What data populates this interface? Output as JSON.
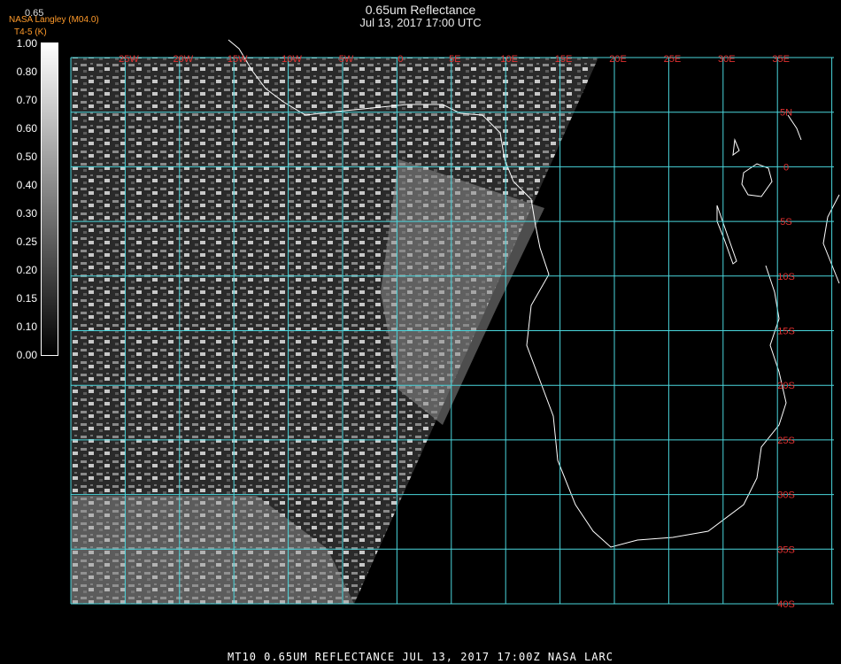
{
  "header": {
    "title": "0.65um Reflectance",
    "datetime": "Jul 13, 2017 17:00 UTC",
    "credit": "NASA Langley (M04.0)",
    "credit2": "T4-5 (K)",
    "scale_top": "0.65"
  },
  "legend": {
    "ticks": [
      "1.00",
      "0.80",
      "0.70",
      "0.60",
      "0.50",
      "0.40",
      "0.30",
      "0.25",
      "0.20",
      "0.15",
      "0.10",
      "0.00"
    ]
  },
  "map": {
    "lon_labels": [
      "25W",
      "20W",
      "15W",
      "10W",
      "5W",
      "0",
      "5E",
      "10E",
      "15E",
      "20E",
      "25E",
      "30E",
      "35E"
    ],
    "lat_labels": [
      "5N",
      "0",
      "5S",
      "10S",
      "15S",
      "20S",
      "25S",
      "30S",
      "35S",
      "40S"
    ],
    "colors": {
      "grid": "#4ad6dc",
      "label": "#e23030",
      "coast": "#ffffff"
    }
  },
  "footer": {
    "text": "MT10  0.65UM REFLECTANCE   JUL 13, 2017 17:00Z   NASA LARC"
  }
}
